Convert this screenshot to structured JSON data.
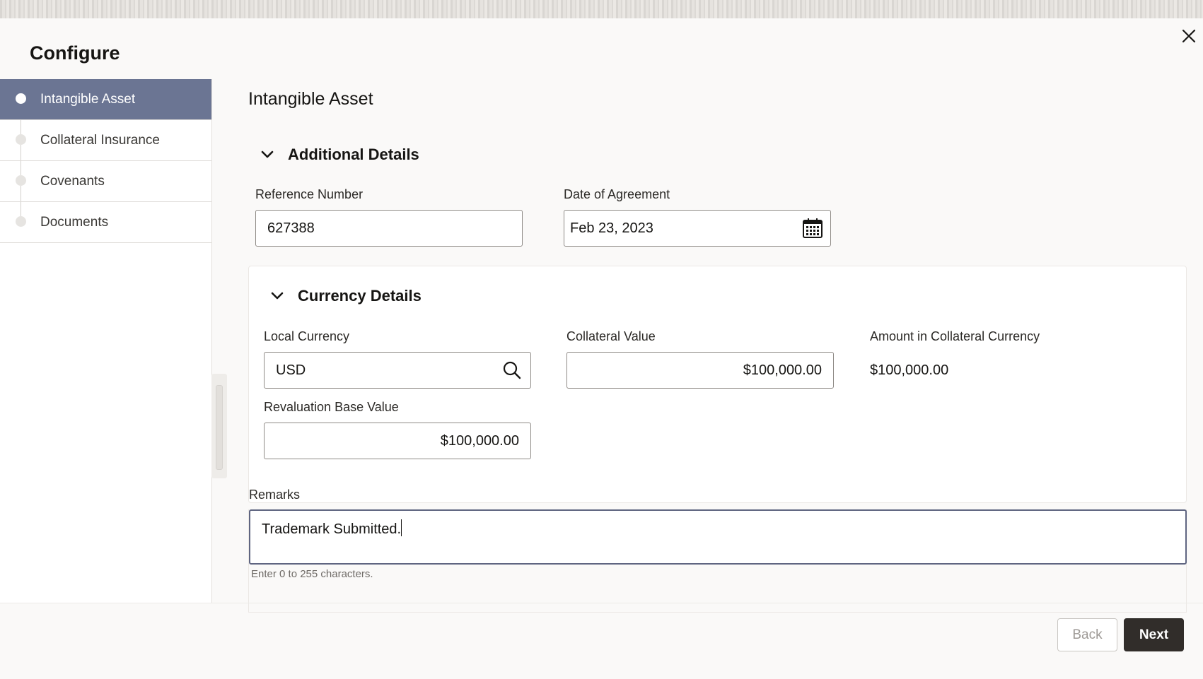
{
  "dialog": {
    "title": "Configure",
    "close_icon": "close-icon"
  },
  "steps": [
    {
      "label": "Intangible Asset",
      "active": true
    },
    {
      "label": "Collateral Insurance",
      "active": false
    },
    {
      "label": "Covenants",
      "active": false
    },
    {
      "label": "Documents",
      "active": false
    }
  ],
  "main": {
    "section_title": "Intangible Asset",
    "additional_details": {
      "header": "Additional Details",
      "reference_number": {
        "label": "Reference Number",
        "value": "627388"
      },
      "date_of_agreement": {
        "label": "Date of Agreement",
        "value": "Feb 23, 2023",
        "icon": "calendar-icon"
      }
    },
    "currency_details": {
      "header": "Currency Details",
      "local_currency": {
        "label": "Local Currency",
        "value": "USD",
        "icon": "search-icon"
      },
      "collateral_value": {
        "label": "Collateral Value",
        "value": "$100,000.00"
      },
      "amount_in_collateral_currency": {
        "label": "Amount in Collateral Currency",
        "value": "$100,000.00"
      },
      "revaluation_base_value": {
        "label": "Revaluation Base Value",
        "value": "$100,000.00"
      }
    },
    "remarks": {
      "label": "Remarks",
      "value": "Trademark Submitted.",
      "hint": "Enter 0 to 255 characters."
    }
  },
  "footer": {
    "back_label": "Back",
    "next_label": "Next"
  },
  "colors": {
    "active_step": "#6b7593",
    "primary_button": "#312d2a",
    "focus_border": "#5f6581"
  }
}
